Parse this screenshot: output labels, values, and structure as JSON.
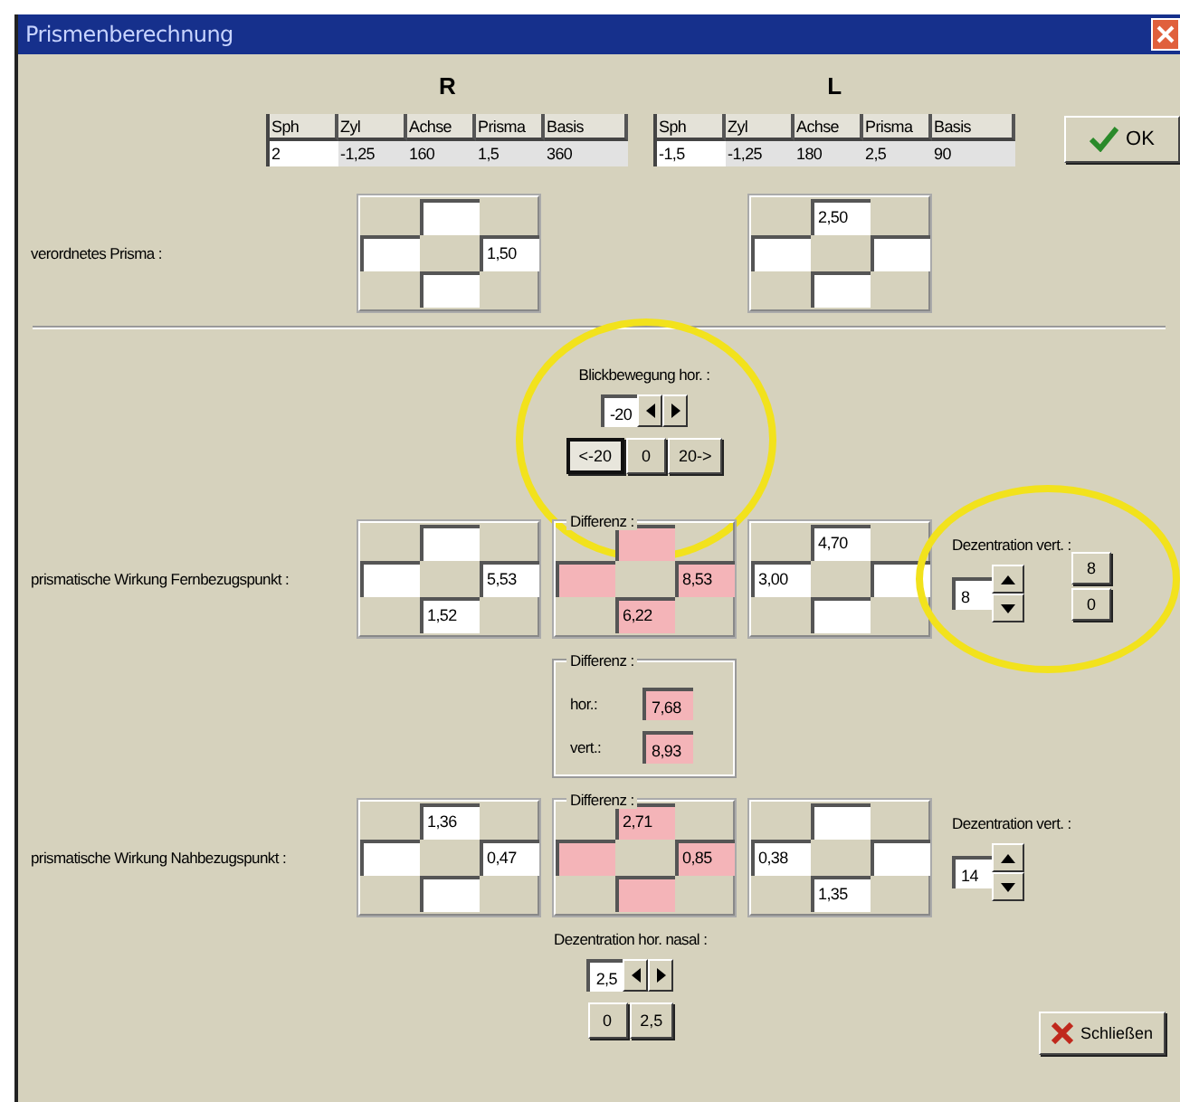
{
  "window": {
    "title": "Prismenberechnung"
  },
  "eyes": [
    {
      "label": "R",
      "columns": [
        "Sph",
        "Zyl",
        "Achse",
        "Prisma",
        "Basis"
      ],
      "values": [
        "2",
        "-1,25",
        "160",
        "1,5",
        "360"
      ]
    },
    {
      "label": "L",
      "columns": [
        "Sph",
        "Zyl",
        "Achse",
        "Prisma",
        "Basis"
      ],
      "values": [
        "-1,5",
        "-1,25",
        "180",
        "2,5",
        "90"
      ]
    }
  ],
  "ok_button": {
    "label": "OK"
  },
  "prescribed_prism": {
    "label": "verordnetes Prisma :",
    "crosses": [
      {
        "top": {
          "highlighted": false
        },
        "left": {
          "highlighted": false
        },
        "right": {
          "value": "1,50",
          "highlighted": false
        },
        "bottom": {
          "highlighted": false
        }
      },
      {
        "top": {
          "value": "2,50",
          "highlighted": false
        },
        "left": {
          "highlighted": false
        },
        "right": {
          "highlighted": false
        },
        "bottom": {
          "highlighted": false
        }
      }
    ]
  },
  "gaze": {
    "label": "Blickbewegung hor. :",
    "value": "-20",
    "circled": true,
    "buttons": [
      {
        "label": "<-20",
        "selected": true
      },
      {
        "label": "0",
        "selected": false
      },
      {
        "label": "20->",
        "selected": false
      }
    ]
  },
  "distance": {
    "label": "prismatische Wirkung Fernbezugspunkt :",
    "crosses": [
      {
        "top": {
          "highlighted": false
        },
        "left": {
          "highlighted": false
        },
        "right": {
          "value": "5,53",
          "highlighted": false
        },
        "bottom": {
          "value": "1,52",
          "highlighted": false
        }
      },
      {
        "title": "Differenz :",
        "top": {
          "highlighted": true
        },
        "left": {
          "highlighted": true
        },
        "right": {
          "value": "8,53",
          "highlighted": true
        },
        "bottom": {
          "value": "6,22",
          "highlighted": true
        }
      },
      {
        "top": {
          "value": "4,70",
          "highlighted": false
        },
        "left": {
          "value": "3,00",
          "highlighted": false
        },
        "right": {
          "highlighted": false
        },
        "bottom": {
          "highlighted": false
        }
      }
    ],
    "decentration": {
      "label": "Dezentration vert. :",
      "value": "8",
      "circled": true,
      "buttons": [
        "8",
        "0"
      ]
    }
  },
  "distance_difference": {
    "title": "Differenz :",
    "rows": [
      {
        "label": "hor.:",
        "value": "7,68",
        "highlighted": true
      },
      {
        "label": "vert.:",
        "value": "8,93",
        "highlighted": true
      }
    ]
  },
  "near": {
    "label": "prismatische Wirkung Nahbezugspunkt :",
    "crosses": [
      {
        "top": {
          "value": "1,36",
          "highlighted": false
        },
        "left": {
          "highlighted": false
        },
        "right": {
          "value": "0,47",
          "highlighted": false
        },
        "bottom": {
          "highlighted": false
        }
      },
      {
        "title": "Differenz :",
        "top": {
          "value": "2,71",
          "highlighted": true
        },
        "left": {
          "highlighted": true
        },
        "right": {
          "value": "0,85",
          "highlighted": true
        },
        "bottom": {
          "highlighted": true
        }
      },
      {
        "top": {
          "highlighted": false
        },
        "left": {
          "value": "0,38",
          "highlighted": false
        },
        "right": {
          "highlighted": false
        },
        "bottom": {
          "value": "1,35",
          "highlighted": false
        }
      }
    ],
    "decentration": {
      "label": "Dezentration vert. :",
      "value": "14",
      "circled": false
    }
  },
  "horizontal_decentration": {
    "label": "Dezentration hor. nasal :",
    "value": "2,5",
    "buttons": [
      "0",
      "2,5"
    ]
  },
  "close_button": {
    "label": "Schließen"
  }
}
